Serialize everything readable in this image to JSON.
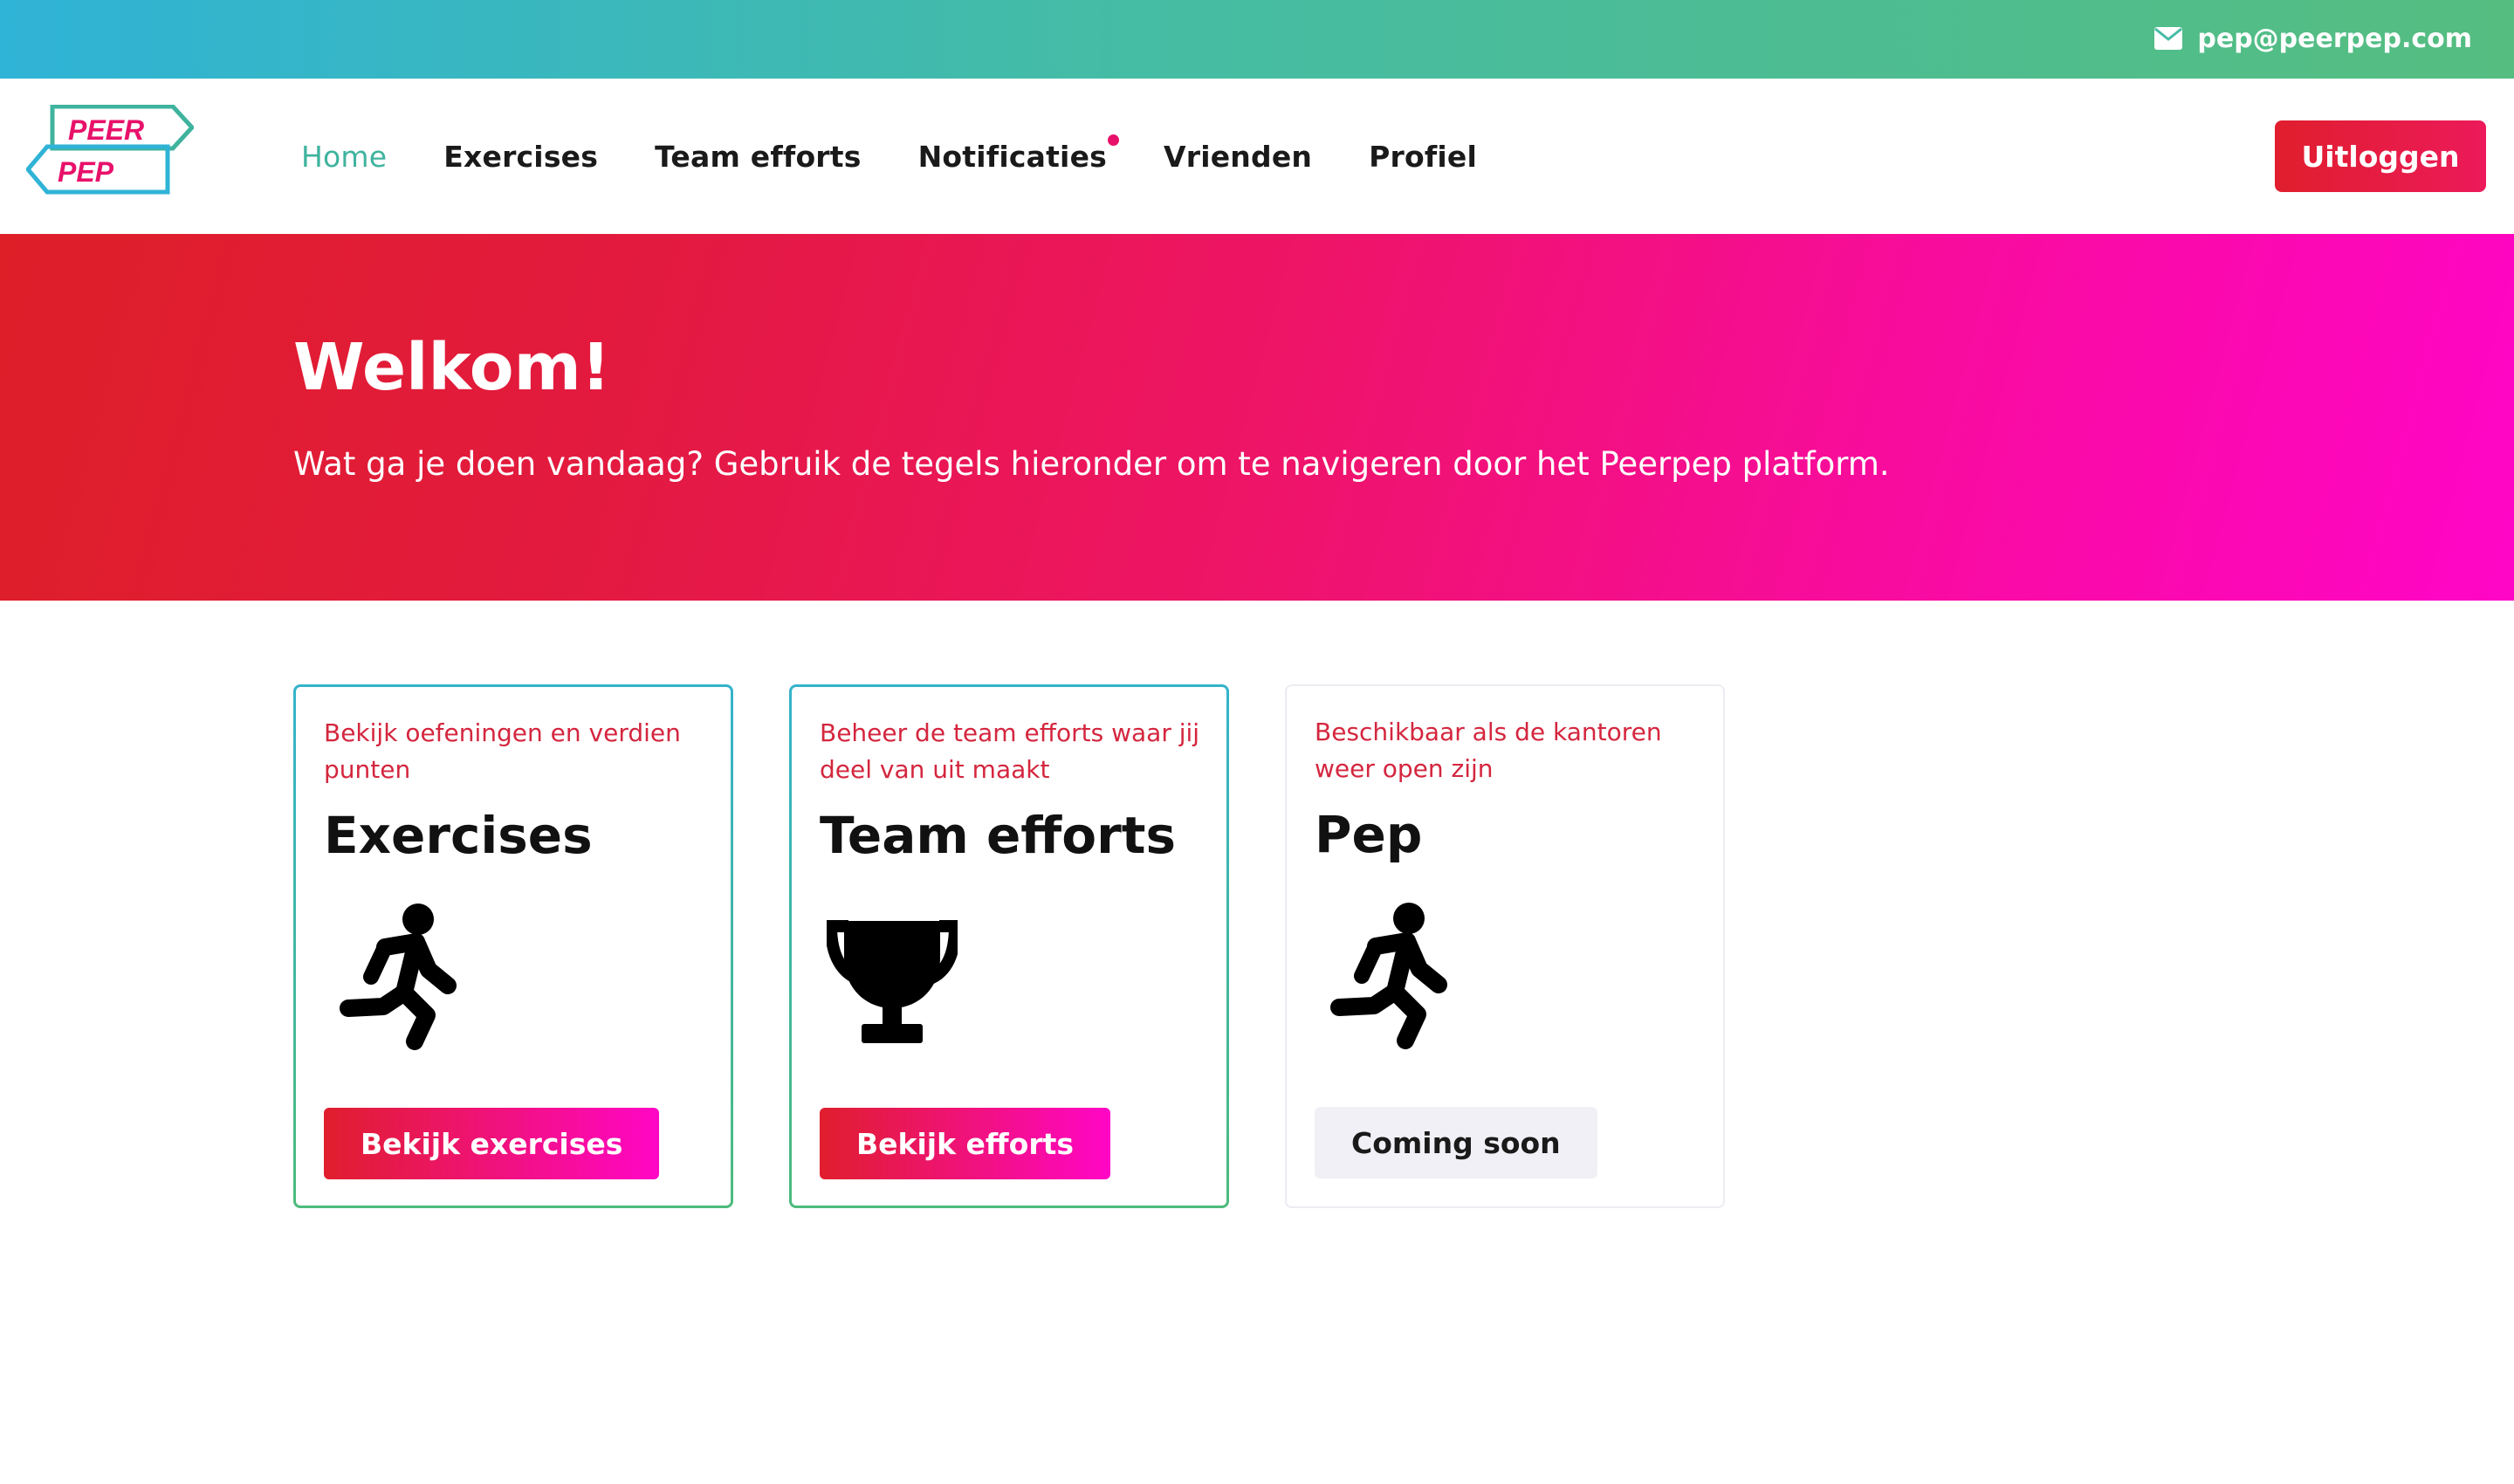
{
  "topbar": {
    "email": "pep@peerpep.com",
    "icon": "envelope-icon"
  },
  "logo": {
    "line1": "PEER",
    "line2": "PEP"
  },
  "nav": {
    "items": [
      {
        "label": "Home",
        "active": true
      },
      {
        "label": "Exercises"
      },
      {
        "label": "Team efforts"
      },
      {
        "label": "Notificaties",
        "has_notification": true
      },
      {
        "label": "Vrienden"
      },
      {
        "label": "Profiel"
      }
    ],
    "logout_label": "Uitloggen"
  },
  "hero": {
    "title": "Welkom!",
    "text": "Wat ga je doen vandaag? Gebruik de tegels hieronder om te navigeren door het Peerpep platform."
  },
  "cards": [
    {
      "subtitle": "Bekijk oefeningen en verdien punten",
      "title": "Exercises",
      "icon": "running-person-icon",
      "button": "Bekijk exercises"
    },
    {
      "subtitle": "Beheer de team efforts waar jij deel van uit maakt",
      "title": "Team efforts",
      "icon": "trophy-icon",
      "button": "Bekijk efforts"
    },
    {
      "subtitle": "Beschikbaar als de kantoren weer open zijn",
      "title": "Pep",
      "icon": "running-person-icon",
      "button": "Coming soon"
    }
  ],
  "colors": {
    "accent_green": "#3fb39e",
    "brand_red": "#e01e2d",
    "brand_pink": "#ff06c6",
    "notification_dot": "#e8116a"
  }
}
